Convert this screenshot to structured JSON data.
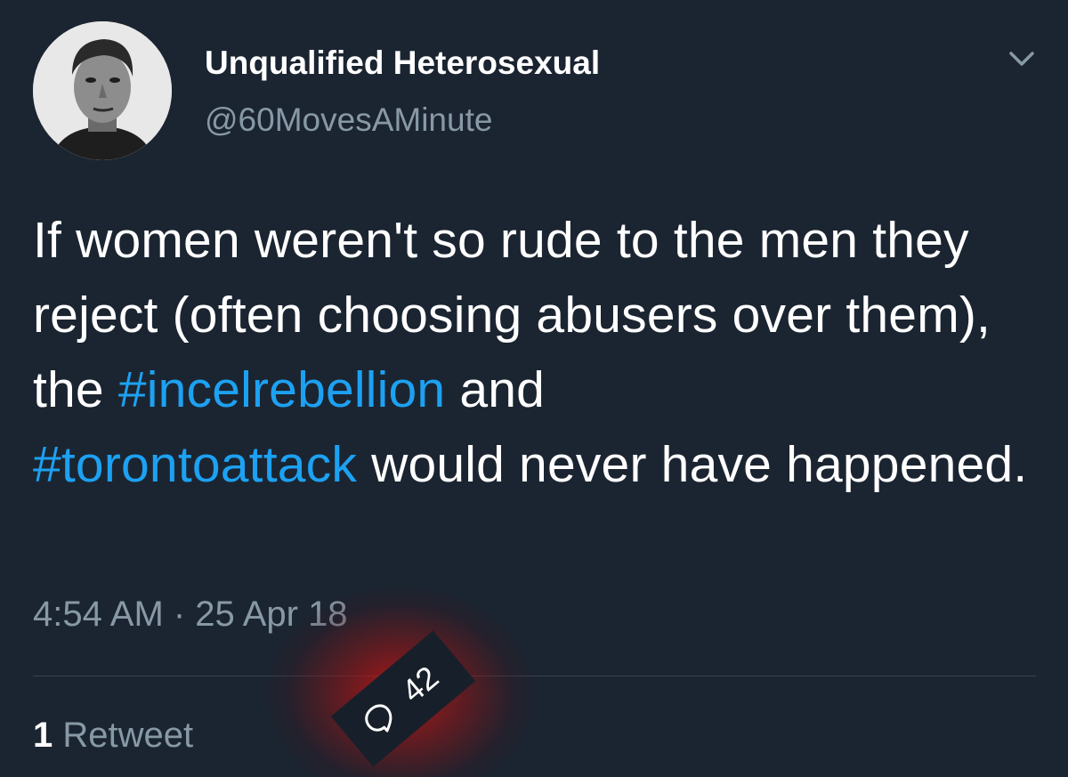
{
  "user": {
    "display_name": "Unqualified Heterosexual",
    "handle": "@60MovesAMinute",
    "avatar_icon": "profile-photo"
  },
  "menu": {
    "icon": "chevron-down-icon"
  },
  "tweet": {
    "text_1": "If women weren't so rude to the men they reject (often choosing abusers over them), the ",
    "hashtag_1": "#incelrebellion",
    "text_2": " and ",
    "hashtag_2": "#torontoattack",
    "text_3": " would never have happened.",
    "timestamp": "4:54 AM · 25 Apr 18"
  },
  "stats": {
    "retweet_count": "1",
    "retweet_label": " Retweet",
    "reply_count": "42",
    "reply_icon": "reply-bubble-icon"
  },
  "colors": {
    "background": "#1b2531",
    "hashtag": "#1da1f2",
    "secondary_text": "#8899a6",
    "highlight": "#c81414"
  }
}
